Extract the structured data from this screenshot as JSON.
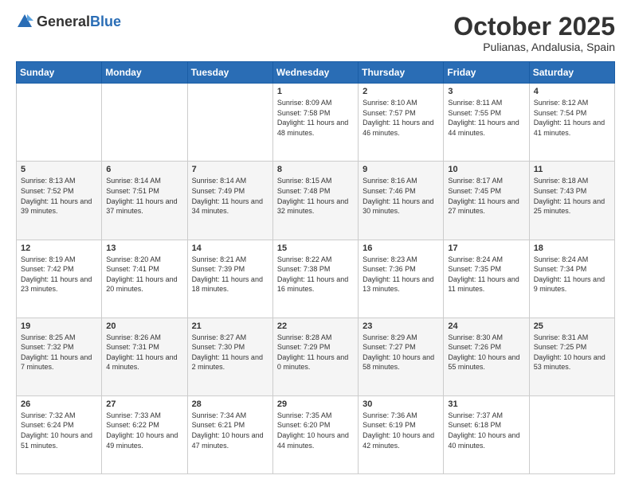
{
  "logo": {
    "general": "General",
    "blue": "Blue"
  },
  "header": {
    "month": "October 2025",
    "location": "Pulianas, Andalusia, Spain"
  },
  "days_of_week": [
    "Sunday",
    "Monday",
    "Tuesday",
    "Wednesday",
    "Thursday",
    "Friday",
    "Saturday"
  ],
  "weeks": [
    [
      {
        "day": "",
        "info": ""
      },
      {
        "day": "",
        "info": ""
      },
      {
        "day": "",
        "info": ""
      },
      {
        "day": "1",
        "info": "Sunrise: 8:09 AM\nSunset: 7:58 PM\nDaylight: 11 hours and 48 minutes."
      },
      {
        "day": "2",
        "info": "Sunrise: 8:10 AM\nSunset: 7:57 PM\nDaylight: 11 hours and 46 minutes."
      },
      {
        "day": "3",
        "info": "Sunrise: 8:11 AM\nSunset: 7:55 PM\nDaylight: 11 hours and 44 minutes."
      },
      {
        "day": "4",
        "info": "Sunrise: 8:12 AM\nSunset: 7:54 PM\nDaylight: 11 hours and 41 minutes."
      }
    ],
    [
      {
        "day": "5",
        "info": "Sunrise: 8:13 AM\nSunset: 7:52 PM\nDaylight: 11 hours and 39 minutes."
      },
      {
        "day": "6",
        "info": "Sunrise: 8:14 AM\nSunset: 7:51 PM\nDaylight: 11 hours and 37 minutes."
      },
      {
        "day": "7",
        "info": "Sunrise: 8:14 AM\nSunset: 7:49 PM\nDaylight: 11 hours and 34 minutes."
      },
      {
        "day": "8",
        "info": "Sunrise: 8:15 AM\nSunset: 7:48 PM\nDaylight: 11 hours and 32 minutes."
      },
      {
        "day": "9",
        "info": "Sunrise: 8:16 AM\nSunset: 7:46 PM\nDaylight: 11 hours and 30 minutes."
      },
      {
        "day": "10",
        "info": "Sunrise: 8:17 AM\nSunset: 7:45 PM\nDaylight: 11 hours and 27 minutes."
      },
      {
        "day": "11",
        "info": "Sunrise: 8:18 AM\nSunset: 7:43 PM\nDaylight: 11 hours and 25 minutes."
      }
    ],
    [
      {
        "day": "12",
        "info": "Sunrise: 8:19 AM\nSunset: 7:42 PM\nDaylight: 11 hours and 23 minutes."
      },
      {
        "day": "13",
        "info": "Sunrise: 8:20 AM\nSunset: 7:41 PM\nDaylight: 11 hours and 20 minutes."
      },
      {
        "day": "14",
        "info": "Sunrise: 8:21 AM\nSunset: 7:39 PM\nDaylight: 11 hours and 18 minutes."
      },
      {
        "day": "15",
        "info": "Sunrise: 8:22 AM\nSunset: 7:38 PM\nDaylight: 11 hours and 16 minutes."
      },
      {
        "day": "16",
        "info": "Sunrise: 8:23 AM\nSunset: 7:36 PM\nDaylight: 11 hours and 13 minutes."
      },
      {
        "day": "17",
        "info": "Sunrise: 8:24 AM\nSunset: 7:35 PM\nDaylight: 11 hours and 11 minutes."
      },
      {
        "day": "18",
        "info": "Sunrise: 8:24 AM\nSunset: 7:34 PM\nDaylight: 11 hours and 9 minutes."
      }
    ],
    [
      {
        "day": "19",
        "info": "Sunrise: 8:25 AM\nSunset: 7:32 PM\nDaylight: 11 hours and 7 minutes."
      },
      {
        "day": "20",
        "info": "Sunrise: 8:26 AM\nSunset: 7:31 PM\nDaylight: 11 hours and 4 minutes."
      },
      {
        "day": "21",
        "info": "Sunrise: 8:27 AM\nSunset: 7:30 PM\nDaylight: 11 hours and 2 minutes."
      },
      {
        "day": "22",
        "info": "Sunrise: 8:28 AM\nSunset: 7:29 PM\nDaylight: 11 hours and 0 minutes."
      },
      {
        "day": "23",
        "info": "Sunrise: 8:29 AM\nSunset: 7:27 PM\nDaylight: 10 hours and 58 minutes."
      },
      {
        "day": "24",
        "info": "Sunrise: 8:30 AM\nSunset: 7:26 PM\nDaylight: 10 hours and 55 minutes."
      },
      {
        "day": "25",
        "info": "Sunrise: 8:31 AM\nSunset: 7:25 PM\nDaylight: 10 hours and 53 minutes."
      }
    ],
    [
      {
        "day": "26",
        "info": "Sunrise: 7:32 AM\nSunset: 6:24 PM\nDaylight: 10 hours and 51 minutes."
      },
      {
        "day": "27",
        "info": "Sunrise: 7:33 AM\nSunset: 6:22 PM\nDaylight: 10 hours and 49 minutes."
      },
      {
        "day": "28",
        "info": "Sunrise: 7:34 AM\nSunset: 6:21 PM\nDaylight: 10 hours and 47 minutes."
      },
      {
        "day": "29",
        "info": "Sunrise: 7:35 AM\nSunset: 6:20 PM\nDaylight: 10 hours and 44 minutes."
      },
      {
        "day": "30",
        "info": "Sunrise: 7:36 AM\nSunset: 6:19 PM\nDaylight: 10 hours and 42 minutes."
      },
      {
        "day": "31",
        "info": "Sunrise: 7:37 AM\nSunset: 6:18 PM\nDaylight: 10 hours and 40 minutes."
      },
      {
        "day": "",
        "info": ""
      }
    ]
  ]
}
